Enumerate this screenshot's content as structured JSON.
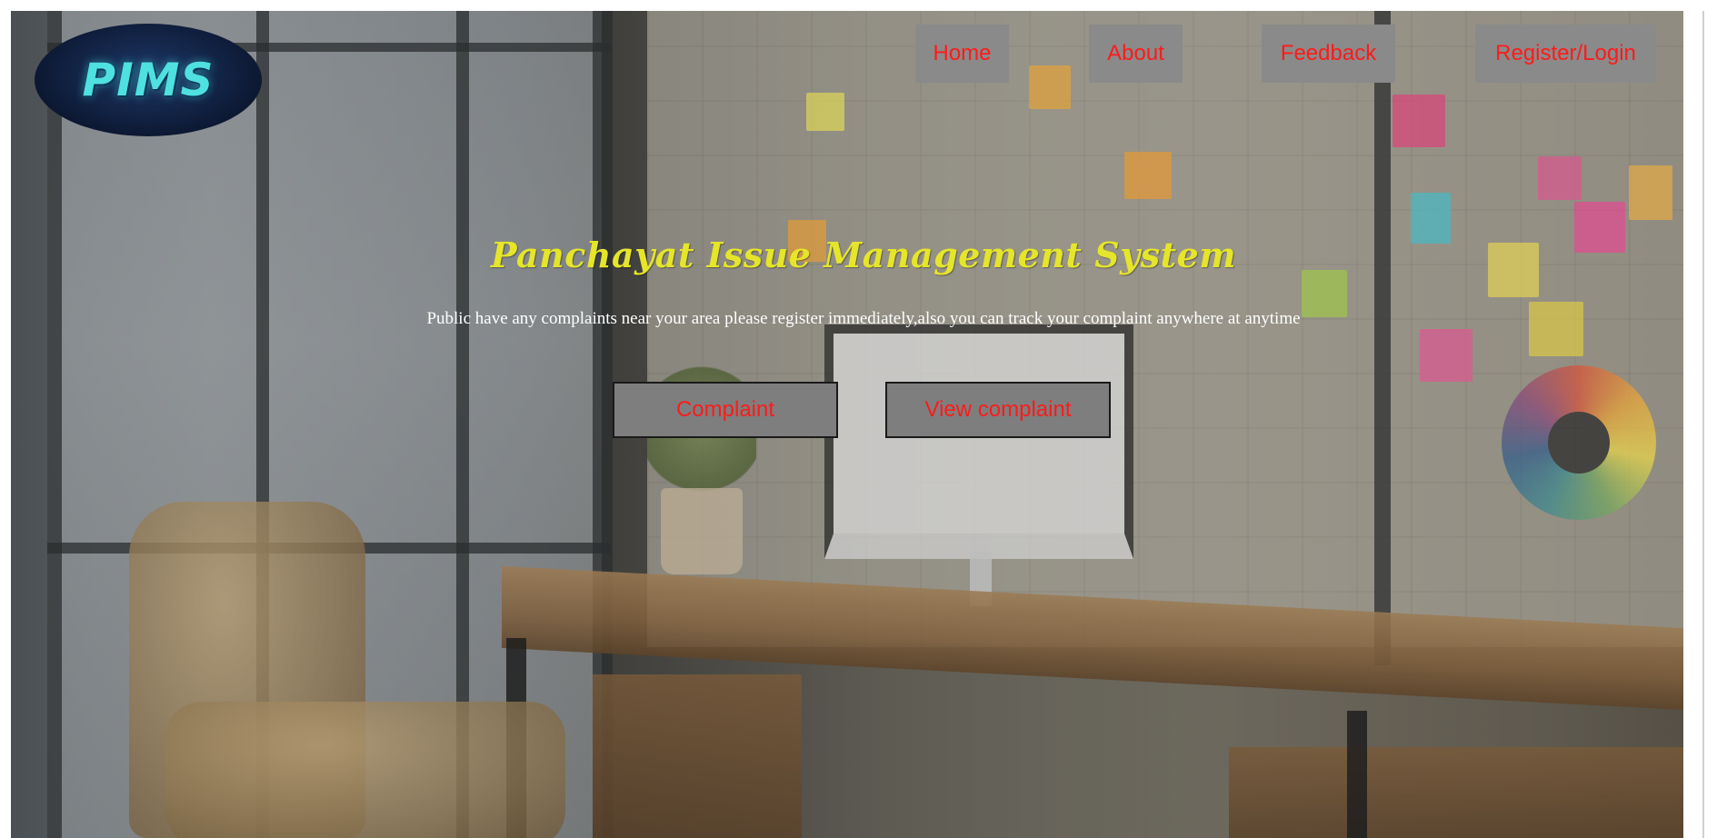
{
  "header": {
    "logo_text": "PIMS",
    "nav": [
      {
        "label": "Home"
      },
      {
        "label": "About"
      },
      {
        "label": "Feedback"
      },
      {
        "label": "Register/Login"
      }
    ]
  },
  "hero": {
    "title": "Panchayat Issue Management System",
    "subtitle": "Public have any complaints near your area please register immediately,also you can track your complaint anywhere at anytime",
    "buttons": [
      {
        "label": "Complaint"
      },
      {
        "label": "View complaint"
      }
    ]
  },
  "colors": {
    "nav_text": "#ff1a1a",
    "nav_bg": "#8a8a8a",
    "title": "#e5e52a",
    "subtitle": "#ffffff"
  }
}
